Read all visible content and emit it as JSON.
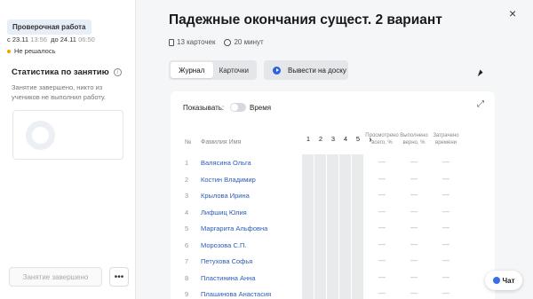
{
  "sidebar": {
    "badge": "Проверочная работа",
    "date_from_prefix": "с",
    "date_from": "23.11",
    "time_from": "13:56",
    "date_to_prefix": "до",
    "date_to": "24.11",
    "time_to": "06:50",
    "status": "Не решалось",
    "stats_title": "Статистика по занятию",
    "stats_desc": "Занятие завершено, никто из учеников не выполнил работу.",
    "finished_button": "Занятие завершено",
    "more_button": "•••"
  },
  "main": {
    "title": "Падежные окончания сущест. 2 вариант",
    "cards_count": "13 карточек",
    "duration": "20 минут",
    "tabs": [
      {
        "label": "Журнал",
        "active": true
      },
      {
        "label": "Карточки",
        "active": false
      }
    ],
    "board_button": "Вывести на доску",
    "close_icon": "×"
  },
  "journal": {
    "show_label": "Показывать:",
    "time_label": "Время",
    "col_num": "№",
    "col_name": "Фамилия Имя",
    "pages": [
      "1",
      "2",
      "3",
      "4",
      "5"
    ],
    "next_icon": "›",
    "col_solved": "Просмотрено всего, %",
    "col_correct": "Выполнено верно, %",
    "col_time": "Затрачено времени",
    "rows": [
      {
        "n": "1",
        "name": "Валясина Ольга"
      },
      {
        "n": "2",
        "name": "Костин Владимир"
      },
      {
        "n": "3",
        "name": "Крылова Ирина"
      },
      {
        "n": "4",
        "name": "Лифшиц Юлия"
      },
      {
        "n": "5",
        "name": "Маргарита Альфовна"
      },
      {
        "n": "6",
        "name": "Морозова С.П."
      },
      {
        "n": "7",
        "name": "Петухова Софья"
      },
      {
        "n": "8",
        "name": "Пластинина Анна"
      },
      {
        "n": "9",
        "name": "Плашинова Анастасия"
      }
    ],
    "dash": "—"
  },
  "chat": {
    "label": "Чат"
  },
  "colors": {
    "accent": "#2b5bb8",
    "status_dot": "#f4a100",
    "badge_bg": "#e8eef8"
  }
}
